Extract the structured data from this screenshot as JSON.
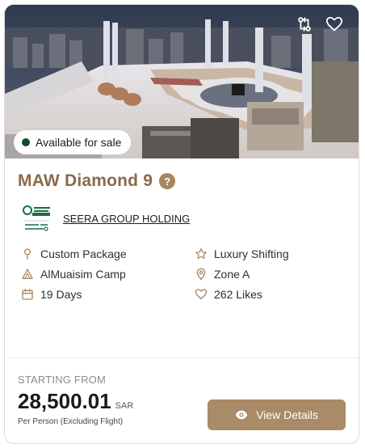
{
  "hero": {
    "image_alt": "Masjid al-Haram aerial view",
    "availability_badge": "Available for sale",
    "badge_color": "#0f4d2c",
    "icons": [
      "compare-icon",
      "heart-icon"
    ]
  },
  "package": {
    "title": "MAW Diamond 9",
    "title_color": "#8b6a4a",
    "help_icon": "?"
  },
  "organizer": {
    "logo_text": "SEERA",
    "name": "SEERA GROUP HOLDING"
  },
  "features": [
    {
      "icon": "pin-icon",
      "label": "Custom Package"
    },
    {
      "icon": "star-icon",
      "label": "Luxury Shifting"
    },
    {
      "icon": "tent-icon",
      "label": "AlMuaisim Camp"
    },
    {
      "icon": "location-icon",
      "label": "Zone A"
    },
    {
      "icon": "calendar-icon",
      "label": "19 Days"
    },
    {
      "icon": "heart-icon",
      "label": "262 Likes"
    }
  ],
  "pricing": {
    "starting_label": "STARTING FROM",
    "amount": "28,500.01",
    "currency": "SAR",
    "note": "Per Person (Excluding Flight)"
  },
  "actions": {
    "view_details_label": "View Details",
    "accent": "#a98b68"
  }
}
